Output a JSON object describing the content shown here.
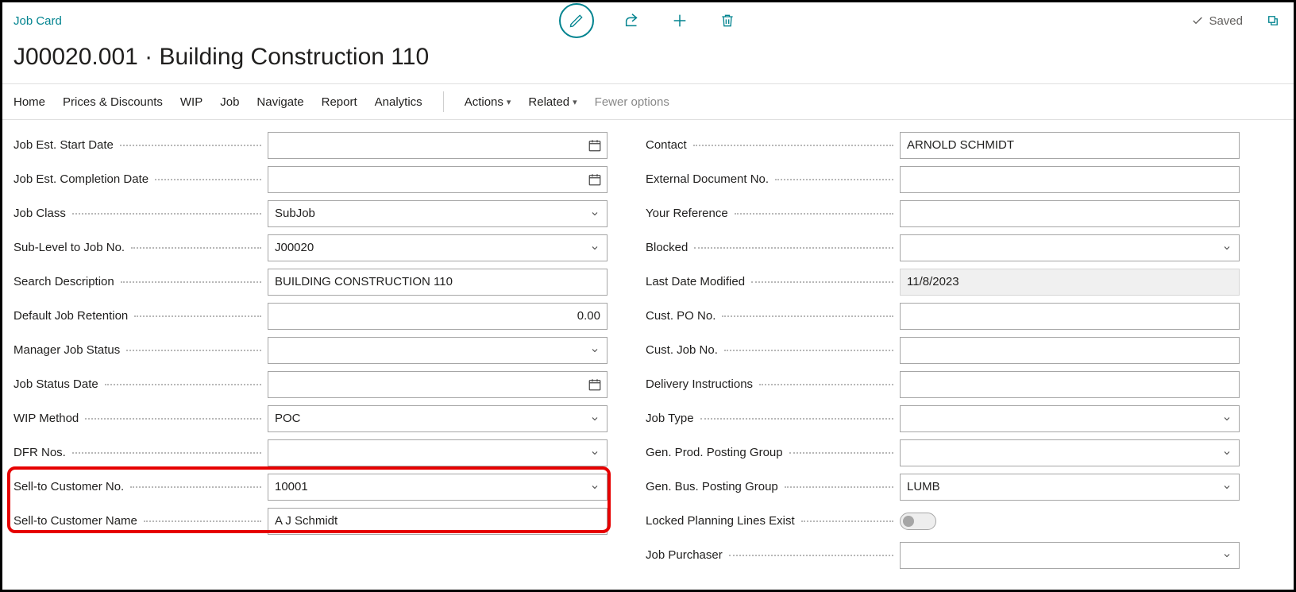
{
  "header": {
    "breadcrumb": "Job Card",
    "title": "J00020.001 · Building Construction 110",
    "saved_status": "Saved"
  },
  "menu": {
    "home": "Home",
    "prices": "Prices & Discounts",
    "wip": "WIP",
    "job": "Job",
    "navigate": "Navigate",
    "report": "Report",
    "analytics": "Analytics",
    "actions": "Actions",
    "related": "Related",
    "fewer": "Fewer options"
  },
  "left": {
    "job_est_start_date": {
      "label": "Job Est. Start Date",
      "value": ""
    },
    "job_est_completion_date": {
      "label": "Job Est. Completion Date",
      "value": ""
    },
    "job_class": {
      "label": "Job Class",
      "value": "SubJob"
    },
    "sub_level": {
      "label": "Sub-Level to Job No.",
      "value": "J00020"
    },
    "search_desc": {
      "label": "Search Description",
      "value": "BUILDING CONSTRUCTION 110"
    },
    "default_retention": {
      "label": "Default Job Retention",
      "value": "0.00"
    },
    "manager_status": {
      "label": "Manager Job Status",
      "value": ""
    },
    "status_date": {
      "label": "Job Status Date",
      "value": ""
    },
    "wip_method": {
      "label": "WIP Method",
      "value": "POC"
    },
    "dfr_nos": {
      "label": "DFR Nos.",
      "value": ""
    },
    "sell_to_no": {
      "label": "Sell-to Customer No.",
      "value": "10001"
    },
    "sell_to_name": {
      "label": "Sell-to Customer Name",
      "value": "A J Schmidt"
    }
  },
  "right": {
    "contact": {
      "label": "Contact",
      "value": "ARNOLD SCHMIDT"
    },
    "ext_doc_no": {
      "label": "External Document No.",
      "value": ""
    },
    "your_ref": {
      "label": "Your Reference",
      "value": ""
    },
    "blocked": {
      "label": "Blocked",
      "value": ""
    },
    "last_modified": {
      "label": "Last Date Modified",
      "value": "11/8/2023"
    },
    "cust_po": {
      "label": "Cust. PO No.",
      "value": ""
    },
    "cust_job": {
      "label": "Cust. Job No.",
      "value": ""
    },
    "delivery": {
      "label": "Delivery Instructions",
      "value": ""
    },
    "job_type": {
      "label": "Job Type",
      "value": ""
    },
    "gen_prod": {
      "label": "Gen. Prod. Posting Group",
      "value": ""
    },
    "gen_bus": {
      "label": "Gen. Bus. Posting Group",
      "value": "LUMB"
    },
    "locked": {
      "label": "Locked Planning Lines Exist",
      "value": false
    },
    "job_purchaser": {
      "label": "Job Purchaser",
      "value": ""
    }
  }
}
